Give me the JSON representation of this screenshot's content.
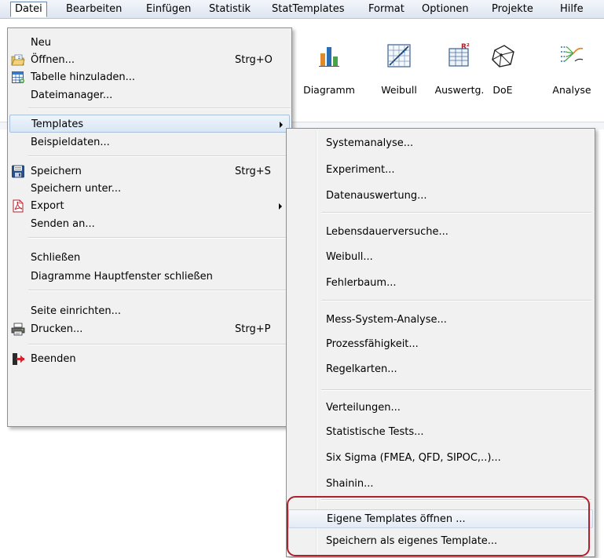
{
  "menubar": {
    "items": [
      "Datei",
      "Bearbeiten",
      "Einfügen",
      "Statistik",
      "StatTemplates",
      "Format",
      "Optionen",
      "Projekte",
      "Hilfe"
    ]
  },
  "toolbar": {
    "items": [
      {
        "label": "Diagramm",
        "icon": "bar-chart-icon"
      },
      {
        "label": "Weibull",
        "icon": "weibull-grid-icon"
      },
      {
        "label": "Auswertg.",
        "icon": "r-squared-table-icon"
      },
      {
        "label": "DoE",
        "icon": "cube-icon"
      },
      {
        "label": "Analyse",
        "icon": "analysis-icon"
      }
    ]
  },
  "datei_menu": {
    "items": [
      {
        "label": "Neu",
        "shortcut": "",
        "icon": ""
      },
      {
        "label": "Öffnen...",
        "shortcut": "Strg+O",
        "icon": "open-folder-icon"
      },
      {
        "label": "Tabelle hinzuladen...",
        "shortcut": "",
        "icon": "table-add-icon"
      },
      {
        "label": "Dateimanager...",
        "shortcut": "",
        "icon": ""
      },
      {
        "label": "Templates",
        "shortcut": "",
        "icon": "",
        "submenu": true
      },
      {
        "label": "Beispieldaten...",
        "shortcut": "",
        "icon": ""
      },
      {
        "label": "Speichern",
        "shortcut": "Strg+S",
        "icon": "save-disk-icon"
      },
      {
        "label": "Speichern unter...",
        "shortcut": "",
        "icon": ""
      },
      {
        "label": "Export",
        "shortcut": "",
        "icon": "pdf-export-icon",
        "submenu": true
      },
      {
        "label": "Senden an...",
        "shortcut": "",
        "icon": ""
      },
      {
        "label": "Schließen",
        "shortcut": "",
        "icon": ""
      },
      {
        "label": "Diagramme Hauptfenster schließen",
        "shortcut": "",
        "icon": ""
      },
      {
        "label": "Seite einrichten...",
        "shortcut": "",
        "icon": ""
      },
      {
        "label": "Drucken...",
        "shortcut": "Strg+P",
        "icon": "printer-icon"
      },
      {
        "label": "Beenden",
        "shortcut": "",
        "icon": "exit-door-icon"
      }
    ]
  },
  "templates_submenu": {
    "items": [
      "Systemanalyse...",
      "Experiment...",
      "Datenauswertung...",
      "Lebensdauerversuche...",
      "Weibull...",
      "Fehlerbaum...",
      "Mess-System-Analyse...",
      "Prozessfähigkeit...",
      "Regelkarten...",
      "Verteilungen...",
      "Statistische Tests...",
      "Six Sigma (FMEA, QFD, SIPOC,..)...",
      "Shainin...",
      "Eigene Templates öffnen ...",
      "Speichern als eigenes Template..."
    ]
  },
  "colors": {
    "highlight_box": "#b0202c",
    "menu_background": "#f1f1f1"
  }
}
